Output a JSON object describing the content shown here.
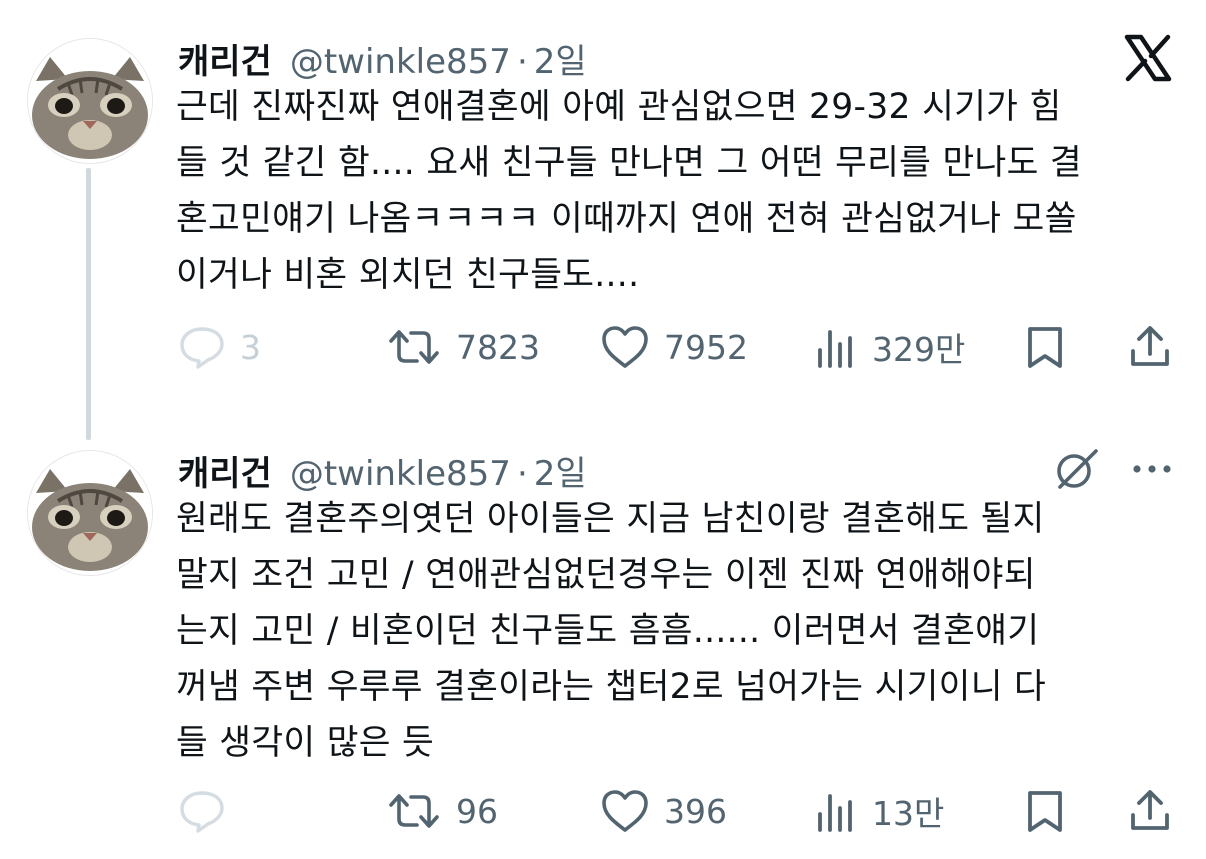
{
  "app": {
    "logo_icon": "x-logo-icon"
  },
  "tweets": [
    {
      "author": {
        "name": "캐리건",
        "handle": "@twinkle857",
        "avatar_icon": "cat-avatar"
      },
      "separator": "·",
      "time": "2일",
      "lines": [
        "근데 진짜진짜 연애결혼에 아예 관심없으면 29-32 시기가 힘",
        "들 것 같긴 함.... 요새 친구들 만나면 그 어떤 무리를 만나도 결",
        "혼고민얘기 나옴ㅋㅋㅋㅋ 이때까지 연애 전혀 관심없거나 모쏠",
        "이거나 비혼 외치던 친구들도...."
      ],
      "stats": {
        "replies": "3",
        "retweets": "7823",
        "likes": "7952",
        "views": "329만"
      }
    },
    {
      "author": {
        "name": "캐리건",
        "handle": "@twinkle857",
        "avatar_icon": "cat-avatar"
      },
      "separator": "·",
      "time": "2일",
      "lines": [
        "원래도 결혼주의엿던 아이들은 지금 남친이랑 결혼해도 될지",
        "말지 조건 고민 / 연애관심없던경우는 이젠 진짜 연애해야되",
        "는지 고민 / 비혼이던 친구들도 흠흠...... 이러면서 결혼얘기",
        "꺼냄 주변 우루루 결혼이라는 챕터2로 넘어가는 시기이니 다",
        "들 생각이 많은 듯"
      ],
      "stats": {
        "replies": "",
        "retweets": "96",
        "likes": "396",
        "views": "13만"
      }
    }
  ],
  "colors": {
    "text": "#0f1419",
    "muted": "#536471",
    "thread_line": "#cfd9de"
  }
}
